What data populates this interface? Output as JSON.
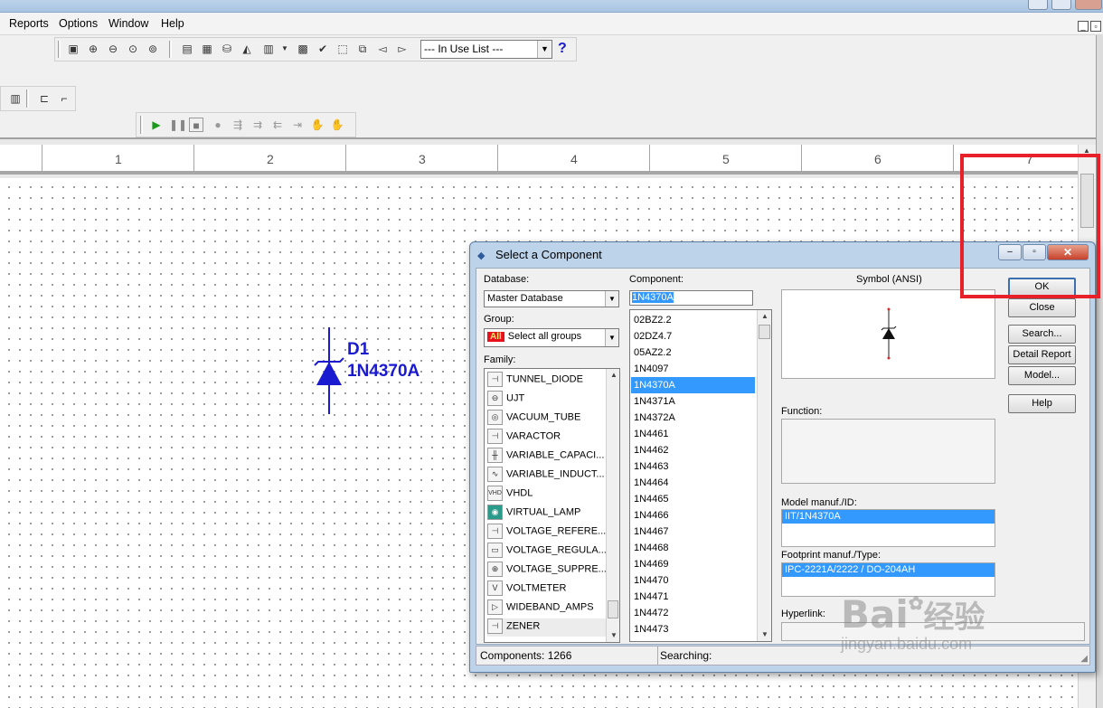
{
  "menubar": {
    "items": [
      {
        "label": "Reports",
        "mnemonic": "R"
      },
      {
        "label": "Options",
        "mnemonic": "O"
      },
      {
        "label": "Window",
        "mnemonic": "W"
      },
      {
        "label": "Help",
        "mnemonic": "H"
      }
    ]
  },
  "toolbar": {
    "in_use_list": "--- In Use List ---",
    "help_icon": "?"
  },
  "ruler": {
    "numbers": [
      "1",
      "2",
      "3",
      "4",
      "5",
      "6",
      "7"
    ]
  },
  "schematic": {
    "reference": "D1",
    "value": "1N4370A"
  },
  "dialog": {
    "title": "Select a Component",
    "database_label": "Database:",
    "database_value": "Master Database",
    "group_label": "Group:",
    "group_badge": "All",
    "group_value": "Select all groups",
    "family_label": "Family:",
    "families": [
      {
        "name": "TUNNEL_DIODE",
        "icon": "tunnel-diode-icon"
      },
      {
        "name": "UJT",
        "icon": "ujt-icon"
      },
      {
        "name": "VACUUM_TUBE",
        "icon": "vacuum-tube-icon"
      },
      {
        "name": "VARACTOR",
        "icon": "varactor-icon"
      },
      {
        "name": "VARIABLE_CAPACI...",
        "icon": "variable-capacitor-icon"
      },
      {
        "name": "VARIABLE_INDUCT...",
        "icon": "variable-inductor-icon"
      },
      {
        "name": "VHDL",
        "icon": "vhdl-icon"
      },
      {
        "name": "VIRTUAL_LAMP",
        "icon": "virtual-lamp-icon"
      },
      {
        "name": "VOLTAGE_REFERE...",
        "icon": "voltage-reference-icon"
      },
      {
        "name": "VOLTAGE_REGULA...",
        "icon": "voltage-regulator-icon"
      },
      {
        "name": "VOLTAGE_SUPPRE...",
        "icon": "voltage-suppressor-icon"
      },
      {
        "name": "VOLTMETER",
        "icon": "voltmeter-icon"
      },
      {
        "name": "WIDEBAND_AMPS",
        "icon": "wideband-amps-icon"
      },
      {
        "name": "ZENER",
        "icon": "zener-icon"
      }
    ],
    "component_label": "Component:",
    "component_value": "1N4370A",
    "components": [
      "02BZ2.2",
      "02DZ4.7",
      "05AZ2.2",
      "1N4097",
      "1N4370A",
      "1N4371A",
      "1N4372A",
      "1N4461",
      "1N4462",
      "1N4463",
      "1N4464",
      "1N4465",
      "1N4466",
      "1N4467",
      "1N4468",
      "1N4469",
      "1N4470",
      "1N4471",
      "1N4472",
      "1N4473"
    ],
    "symbol_label": "Symbol (ANSI)",
    "function_label": "Function:",
    "model_label": "Model manuf./ID:",
    "model_value": "IIT/1N4370A",
    "footprint_label": "Footprint manuf./Type:",
    "footprint_value": "IPC-2221A/2222 / DO-204AH",
    "hyperlink_label": "Hyperlink:",
    "buttons": {
      "ok": "OK",
      "close": "Close",
      "search": "Search...",
      "detail_report": "Detail Report",
      "model": "Model...",
      "help": "Help"
    },
    "status_components": "Components: 1266",
    "status_searching": "Searching:"
  },
  "watermark": {
    "brand": "Bai",
    "brand_cn": "经验",
    "url": "jingyan.baidu.com"
  },
  "colors": {
    "selection": "#3399ff",
    "schematic_blue": "#1a1ad0",
    "highlight_red": "#e8202a"
  }
}
